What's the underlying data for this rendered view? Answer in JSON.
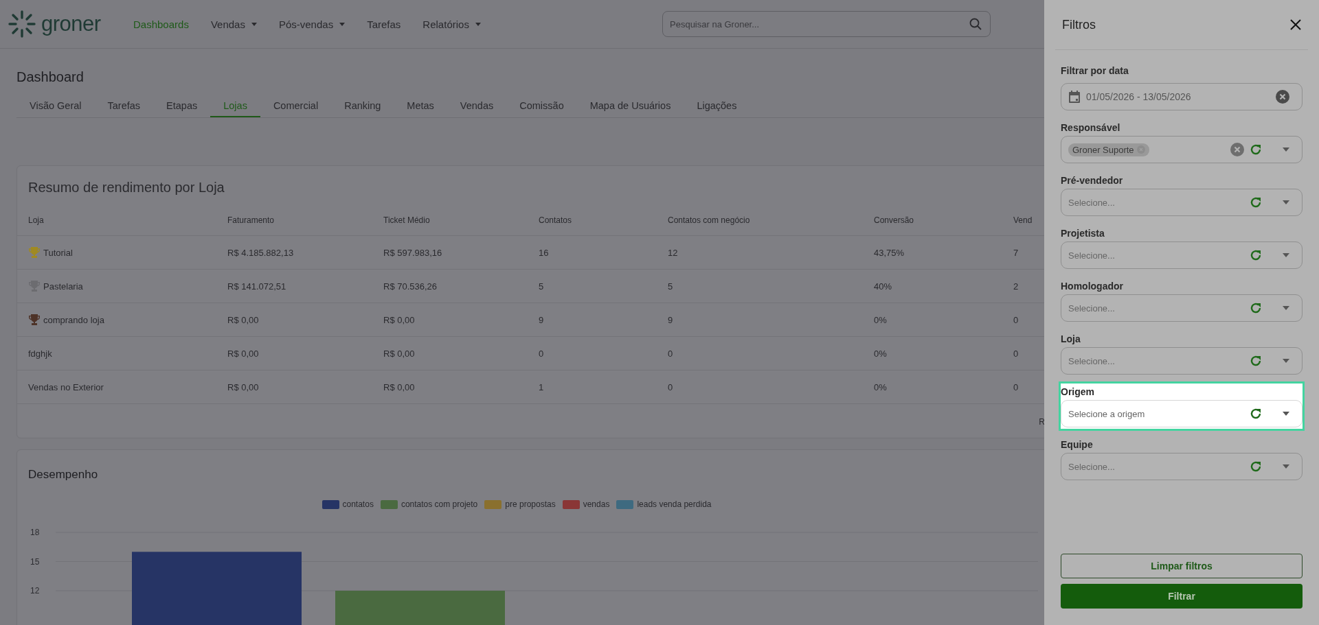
{
  "nav": {
    "logo": "groner",
    "items": [
      {
        "label": "Dashboards",
        "selected": true,
        "dropdown": false
      },
      {
        "label": "Vendas",
        "selected": false,
        "dropdown": true
      },
      {
        "label": "Pós-vendas",
        "selected": false,
        "dropdown": true
      },
      {
        "label": "Tarefas",
        "selected": false,
        "dropdown": false
      },
      {
        "label": "Relatórios",
        "selected": false,
        "dropdown": true
      }
    ],
    "search": {
      "placeholder": "Pesquisar na Groner..."
    }
  },
  "page_title": "Dashboard",
  "tabs": [
    {
      "label": "Visão Geral",
      "selected": false
    },
    {
      "label": "Tarefas",
      "selected": false
    },
    {
      "label": "Etapas",
      "selected": false
    },
    {
      "label": "Lojas",
      "selected": true
    },
    {
      "label": "Comercial",
      "selected": false
    },
    {
      "label": "Ranking",
      "selected": false
    },
    {
      "label": "Metas",
      "selected": false
    },
    {
      "label": "Vendas",
      "selected": false
    },
    {
      "label": "Comissão",
      "selected": false
    },
    {
      "label": "Mapa de Usuários",
      "selected": false
    },
    {
      "label": "Ligações",
      "selected": false
    }
  ],
  "summary": {
    "title": "Resumo de rendimento por Loja",
    "columns": [
      "Loja",
      "Faturamento",
      "Ticket Médio",
      "Contatos",
      "Contatos com negócio",
      "Conversão",
      "Vend"
    ],
    "rows": [
      {
        "color": "#a08a22",
        "cells": [
          "Tutorial",
          "R$ 4.185.882,13",
          "R$ 597.983,16",
          "16",
          "12",
          "43,75%",
          "7"
        ]
      },
      {
        "color": "#6c6c70",
        "cells": [
          "Pastelaria",
          "R$ 141.072,51",
          "R$ 70.536,26",
          "5",
          "5",
          "40%",
          "2"
        ]
      },
      {
        "color": "#4e3328",
        "cells": [
          "comprando loja",
          "R$ 0,00",
          "R$ 0,00",
          "9",
          "9",
          "0%",
          "0"
        ]
      },
      {
        "cells": [
          "fdghjk",
          "R$ 0,00",
          "R$ 0,00",
          "0",
          "0",
          "0%",
          "0"
        ]
      },
      {
        "cells": [
          "Vendas no Exterior",
          "R$ 0,00",
          "R$ 0,00",
          "1",
          "0",
          "0%",
          "0"
        ]
      }
    ],
    "footer_text": "R"
  },
  "performance": {
    "title": "Desempenho",
    "chart_data": {
      "type": "bar",
      "grid": true,
      "ylim": [
        0,
        18
      ],
      "yticks": [
        12,
        15,
        18
      ],
      "series": [
        {
          "name": "contatos",
          "color": "#263465",
          "values": [
            16
          ]
        },
        {
          "name": "contatos com projeto",
          "color": "#4a6a40",
          "values": [
            12
          ]
        },
        {
          "name": "pre propostas",
          "color": "#8a702e",
          "values": [
            null
          ]
        },
        {
          "name": "vendas",
          "color": "#8a3636",
          "values": [
            null
          ]
        },
        {
          "name": "leads venda perdida",
          "color": "#3e6a80",
          "values": [
            null
          ]
        }
      ]
    }
  },
  "filters": {
    "title": "Filtros",
    "fields": [
      {
        "kind": "date",
        "label": "Filtrar por data",
        "value": "01/05/2026 - 13/05/2026",
        "highlighted": false
      },
      {
        "kind": "multi",
        "label": "Responsável",
        "chips": [
          "Groner Suporte"
        ],
        "highlighted": false
      },
      {
        "kind": "select",
        "label": "Pré-vendedor",
        "placeholder": "Selecione...",
        "highlighted": false
      },
      {
        "kind": "select",
        "label": "Projetista",
        "placeholder": "Selecione...",
        "highlighted": false
      },
      {
        "kind": "select",
        "label": "Homologador",
        "placeholder": "Selecione...",
        "highlighted": false
      },
      {
        "kind": "select",
        "label": "Loja",
        "placeholder": "Selecione...",
        "highlighted": false
      },
      {
        "kind": "select",
        "label": "Origem",
        "placeholder": "Selecione a origem",
        "highlighted": true
      },
      {
        "kind": "select",
        "label": "Equipe",
        "placeholder": "Selecione...",
        "highlighted": false
      }
    ],
    "clear_button": "Limpar filtros",
    "apply_button": "Filtrar"
  }
}
